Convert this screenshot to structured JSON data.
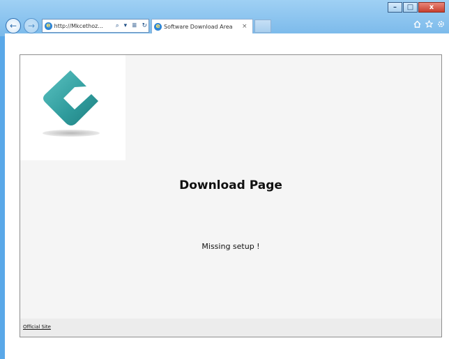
{
  "browser": {
    "url": "http://Mkcethoz...",
    "tab_title": "Software Download Area",
    "tab_close": "×",
    "back_glyph": "←",
    "forward_glyph": "→",
    "address_icons": "⌕ ▾ ≣ ↻",
    "toolbar_icons": [
      "home-icon",
      "favorites-icon",
      "settings-icon"
    ],
    "window_controls": {
      "minimize": "–",
      "maximize": "□",
      "close": "x"
    }
  },
  "page": {
    "title": "Download Page",
    "message": "Missing setup !",
    "footer_link": "Official Site"
  },
  "colors": {
    "titlebar": "#7ab9ea",
    "logo_teal": "#3aa7a7",
    "page_bg": "#f5f5f5"
  }
}
